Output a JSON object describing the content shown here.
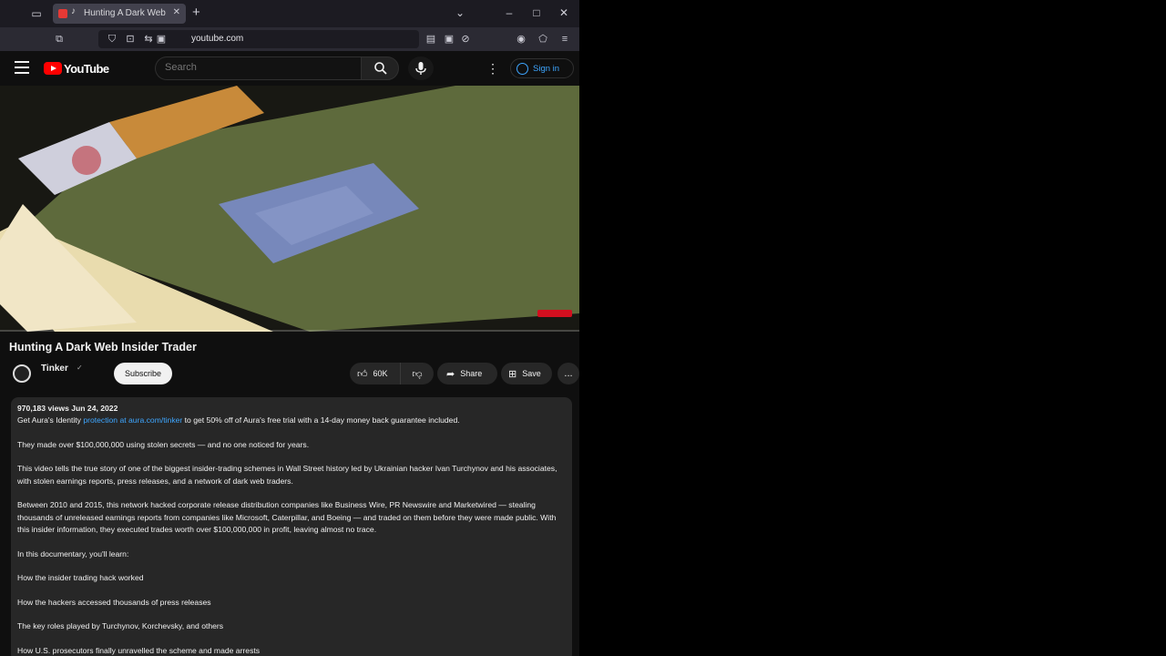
{
  "browser": {
    "tab_title": "Hunting A Dark Web Insider Trader",
    "url": "youtube.com"
  },
  "header": {
    "logo_text": "YouTube",
    "search_placeholder": "Search",
    "signin_label": "Sign in"
  },
  "video": {
    "progress_fraction": 0.0,
    "brand_color": "#ff0000"
  },
  "meta": {
    "title": "Hunting A Dark Web Insider Trader",
    "channel_name": "Tinker",
    "verified_mark": "✓",
    "subscribe_label": "Subscribe",
    "like_count": "60K",
    "share_label": "Share",
    "save_label": "Save",
    "more_label": "..."
  },
  "description": {
    "stats": "970,183 views Jun 24, 2022",
    "lines": [
      {
        "pre": "Get Aura's Identity",
        "link": "protection at aura.com/tinker",
        "post": " to get 50% off of Aura's free trial with a 14-day money back guarantee included."
      },
      {
        "text": "They made over $100,000,000 using stolen secrets — and no one noticed for years."
      },
      {
        "text": "This video tells the true story of one of the biggest insider-trading schemes in Wall Street history led by Ukrainian hacker Ivan Turchynov and his associates, with stolen earnings reports, press releases, and a network of dark web traders."
      },
      {
        "text": "Between 2010 and 2015, this network hacked corporate release distribution companies like Business Wire, PR Newswire and Marketwired — stealing thousands of unreleased earnings reports from companies like Microsoft, Caterpillar, and Boeing — and traded on them before they were made public. With this insider information, they executed trades worth over $100,000,000 in profit, leaving almost no trace."
      },
      {
        "text": "In this documentary, you'll learn:"
      },
      {
        "text": "How the insider trading hack worked"
      },
      {
        "text": "How the hackers accessed thousands of press releases"
      },
      {
        "text": "The key roles played by Turchynov, Korchevsky, and others"
      },
      {
        "text": "How U.S. prosecutors finally unravelled the scheme and made arrests"
      }
    ]
  }
}
